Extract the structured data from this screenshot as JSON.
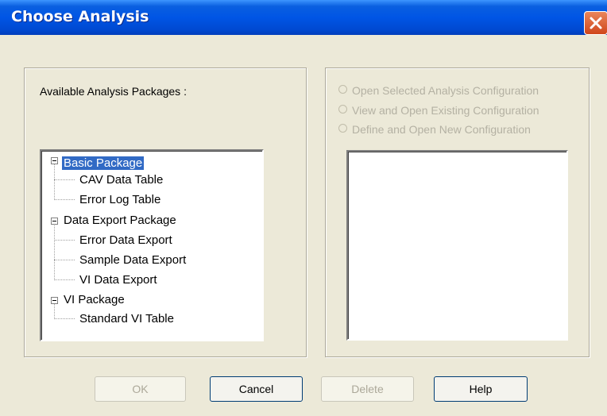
{
  "window": {
    "title": "Choose Analysis",
    "title_bar_color": "#0055e5",
    "close_button_color": "#d9521f"
  },
  "left_panel": {
    "label": "Available Analysis Packages :",
    "tree": [
      {
        "label": "Basic Package",
        "level": 0,
        "expanded": true,
        "selected": true
      },
      {
        "label": "CAV Data Table",
        "level": 1
      },
      {
        "label": "Error Log Table",
        "level": 1
      },
      {
        "label": "Data Export Package",
        "level": 0,
        "expanded": true
      },
      {
        "label": "Error Data Export",
        "level": 1
      },
      {
        "label": "Sample Data Export",
        "level": 1
      },
      {
        "label": "VI Data Export",
        "level": 1
      },
      {
        "label": "VI Package",
        "level": 0,
        "expanded": true
      },
      {
        "label": "Standard VI Table",
        "level": 1
      }
    ]
  },
  "right_panel": {
    "options": [
      {
        "label": "Open Selected Analysis Configuration",
        "enabled": false
      },
      {
        "label": "View and Open Existing Configuration",
        "enabled": false
      },
      {
        "label": "Define and Open New Configuration",
        "enabled": false
      }
    ]
  },
  "buttons": {
    "ok": "OK",
    "cancel": "Cancel",
    "delete": "Delete",
    "help": "Help"
  },
  "colors": {
    "dialog_bg": "#ece9d8",
    "selection": "#316ac5",
    "disabled_text": "#aca899"
  }
}
